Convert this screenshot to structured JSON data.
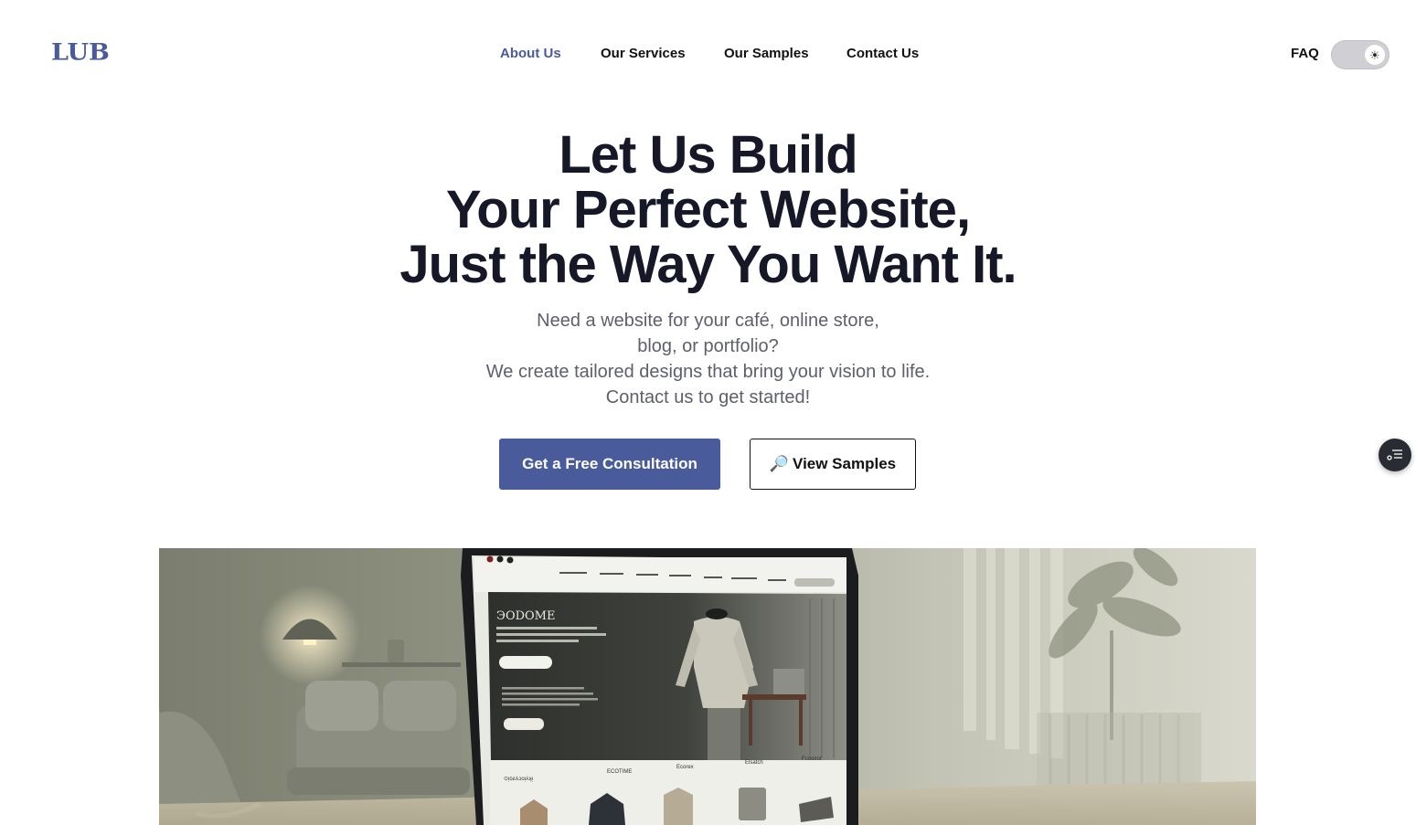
{
  "brand": {
    "logo": "LUB",
    "accent_color": "#4a5b9c"
  },
  "nav": {
    "links": [
      {
        "label": "About Us",
        "active": true
      },
      {
        "label": "Our Services",
        "active": false
      },
      {
        "label": "Our Samples",
        "active": false
      },
      {
        "label": "Contact Us",
        "active": false
      }
    ],
    "faq_label": "FAQ",
    "theme_toggle": {
      "icon": "sun-icon",
      "mode": "light"
    }
  },
  "hero": {
    "title_lines": [
      "Let Us Build",
      "Your Perfect Website,",
      "Just the Way You Want It."
    ],
    "subtitle_lines": [
      "Need a website for your café, online store,",
      "blog, or portfolio?",
      "We create tailored designs that bring your vision to life.",
      "Contact us to get started!"
    ],
    "primary_button": "Get a Free Consultation",
    "secondary_button": {
      "icon": "🔎",
      "label": "View Samples"
    },
    "floating_button_icon": "list-menu-icon"
  },
  "mockup": {
    "brand": "ЭODOME",
    "section_label": "⊙ᴉᴅƨ⅄ɔoᴉ⅄ʞᴉ",
    "product_labels": [
      "ECOTIME",
      "Ecorex",
      "Elsatch",
      "Fcooirot"
    ]
  }
}
